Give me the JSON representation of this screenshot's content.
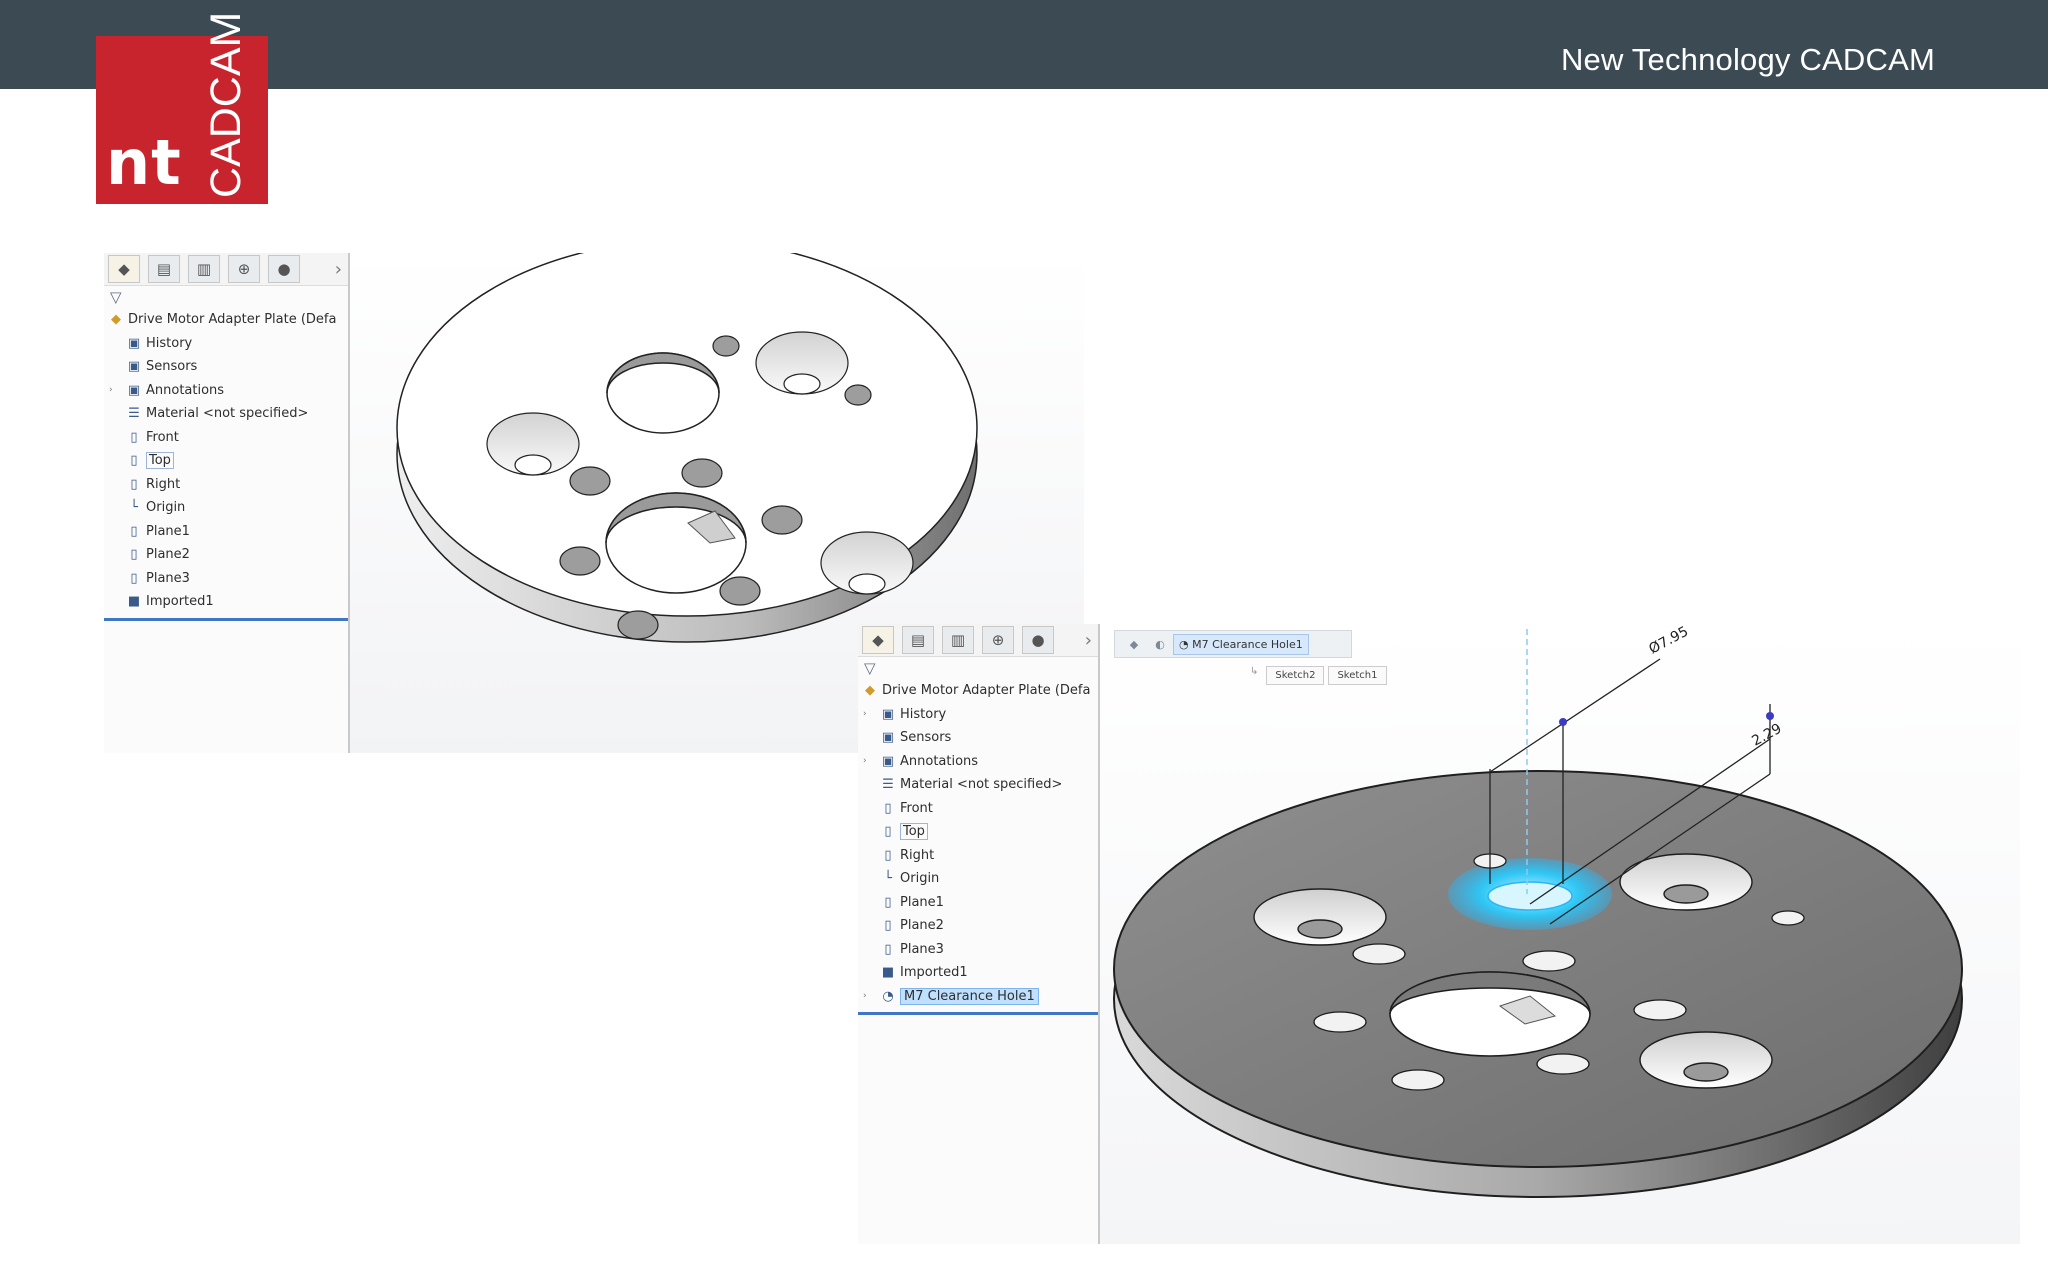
{
  "header": {
    "company": "New Technology CADCAM"
  },
  "logo": {
    "short": "nt",
    "word": "CADCAM",
    "color": "#c8242d"
  },
  "theme": {
    "bar": "#3b4a53",
    "highlight": "#29b6f6"
  },
  "shot1": {
    "tabs": [
      "part-icon",
      "featuremanager-icon",
      "property-icon",
      "configuration-icon",
      "appearance-icon"
    ],
    "tree": {
      "root": "Drive Motor Adapter Plate  (Defa",
      "items": [
        "History",
        "Sensors",
        "Annotations",
        "Material <not specified>",
        "Front",
        "Top",
        "Right",
        "Origin",
        "Plane1",
        "Plane2",
        "Plane3",
        "Imported1"
      ]
    }
  },
  "shot2": {
    "tree": {
      "root": "Drive Motor Adapter Plate  (Defa",
      "items": [
        "History",
        "Sensors",
        "Annotations",
        "Material <not specified>",
        "Front",
        "Top",
        "Right",
        "Origin",
        "Plane1",
        "Plane2",
        "Plane3",
        "Imported1",
        "M7 Clearance Hole1"
      ]
    },
    "context": {
      "feature": "M7 Clearance Hole1",
      "sketches": [
        "Sketch2",
        "Sketch1"
      ]
    },
    "dimensions": {
      "diameter": "Ø7.95",
      "offset": "2.29"
    }
  }
}
